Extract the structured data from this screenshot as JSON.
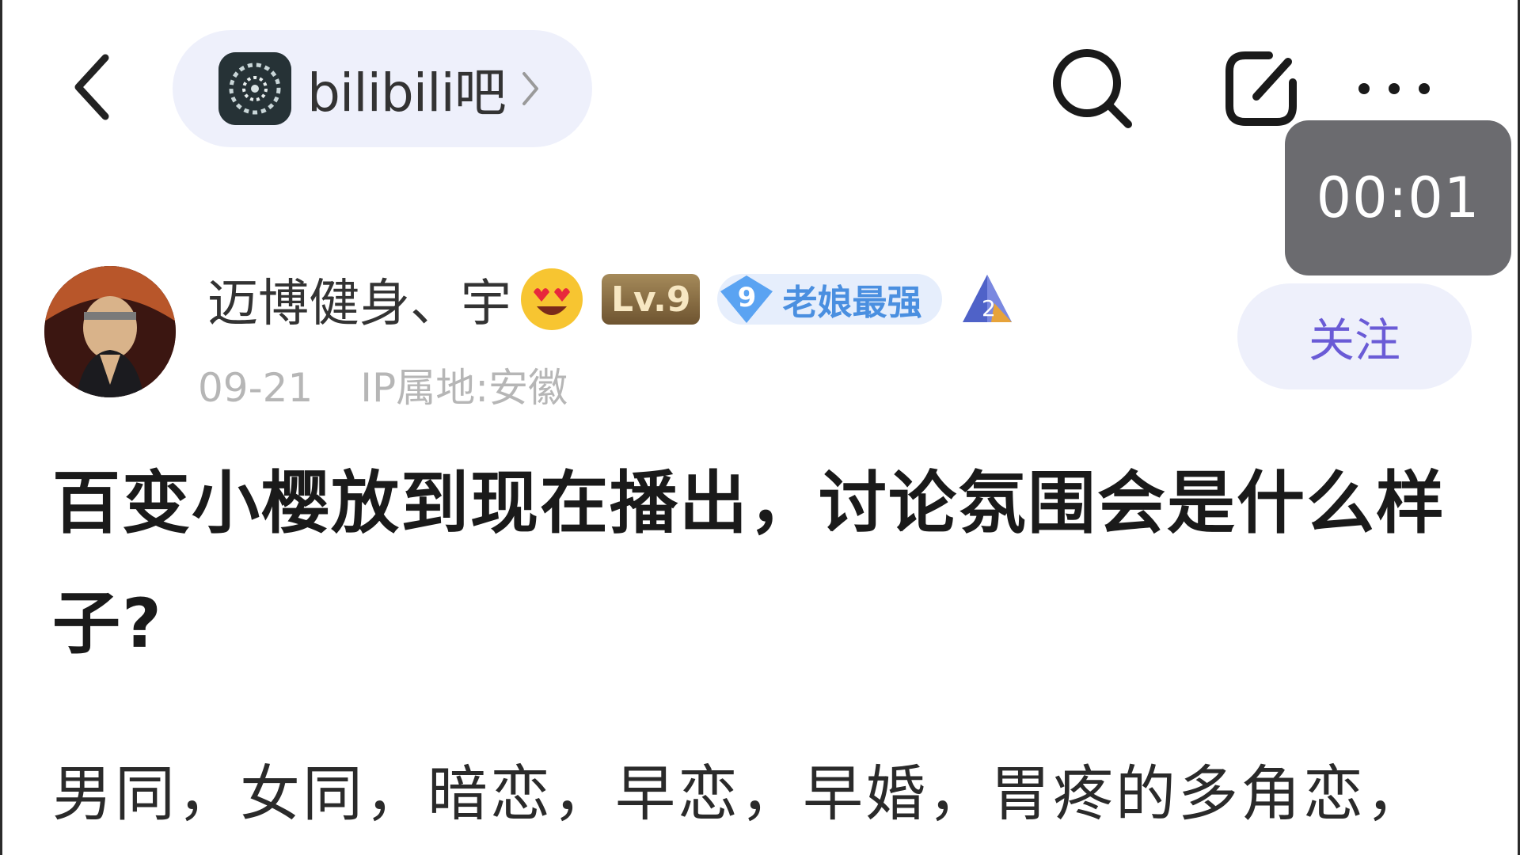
{
  "header": {
    "forum_name": "bilibili吧",
    "icons": [
      "back-arrow-icon",
      "search-icon",
      "edit-icon",
      "more-icon"
    ]
  },
  "timer": "00:01",
  "author": {
    "name": "迈博健身、宇",
    "level": "Lv.9",
    "member_level": "9",
    "member_title": "老娘最强",
    "extra_badge": "2",
    "date": "09-21",
    "ip": "IP属地:安徽"
  },
  "follow_label": "关注",
  "post": {
    "title": "百变小樱放到现在播出，讨论氛围会是什么样子?",
    "body": "男同，女同，暗恋，早恋，早婚，胃疼的多角恋，"
  },
  "colors": {
    "accent": "#6a5bd6",
    "pill_bg": "#eef0fb",
    "member_blue": "#4a8fe0",
    "timer_bg": "#6b6b6f"
  }
}
